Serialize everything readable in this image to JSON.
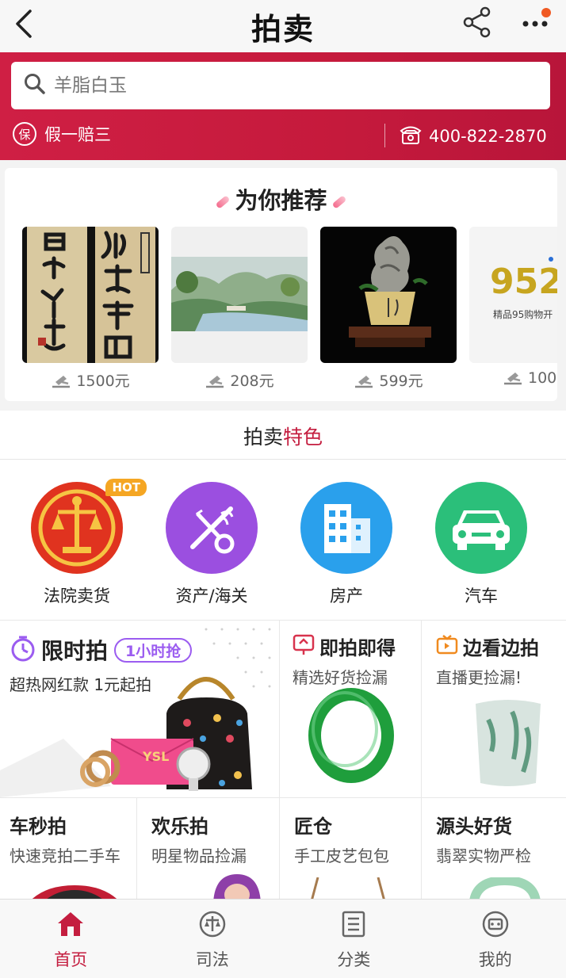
{
  "header": {
    "title": "拍卖"
  },
  "search": {
    "placeholder": "羊脂白玉"
  },
  "guarantee": {
    "icon_text": "保",
    "label": "假一赔三"
  },
  "hotline": {
    "number": "400-822-2870"
  },
  "recommend": {
    "title": "为你推荐",
    "items": [
      {
        "price": "1500元"
      },
      {
        "price": "208元"
      },
      {
        "price": "599元"
      },
      {
        "price": "100",
        "image_text": "952",
        "image_subtext": "精品95购物开"
      }
    ]
  },
  "features": {
    "title_plain": "拍卖",
    "title_highlight": "特色",
    "items": [
      {
        "label": "法院卖货",
        "badge": "HOT",
        "color": "#e0331f"
      },
      {
        "label": "资产/海关",
        "color": "#9b4fe0"
      },
      {
        "label": "房产",
        "color": "#2aa0ec"
      },
      {
        "label": "汽车",
        "color": "#2bbf7a"
      }
    ]
  },
  "grid": {
    "flash": {
      "title": "限时拍",
      "badge": "1小时抢",
      "subtitle": "超热网红款  1元起拍",
      "bag_brand": "YSL"
    },
    "instant": {
      "title": "即拍即得",
      "subtitle": "精选好货捡漏"
    },
    "live": {
      "title": "边看边拍",
      "subtitle": "直播更捡漏!"
    },
    "car": {
      "title": "车秒拍",
      "subtitle": "快速竞拍二手车"
    },
    "fun": {
      "title": "欢乐拍",
      "subtitle": "明星物品捡漏"
    },
    "craft": {
      "title": "匠仓",
      "subtitle": "手工皮艺包包"
    },
    "source": {
      "title": "源头好货",
      "subtitle": "翡翠实物严检"
    }
  },
  "nav": {
    "tabs": [
      {
        "label": "首页"
      },
      {
        "label": "司法"
      },
      {
        "label": "分类"
      },
      {
        "label": "我的"
      }
    ]
  },
  "colors": {
    "brand_red": "#c41d3f",
    "accent_purple": "#9b5cf0"
  }
}
